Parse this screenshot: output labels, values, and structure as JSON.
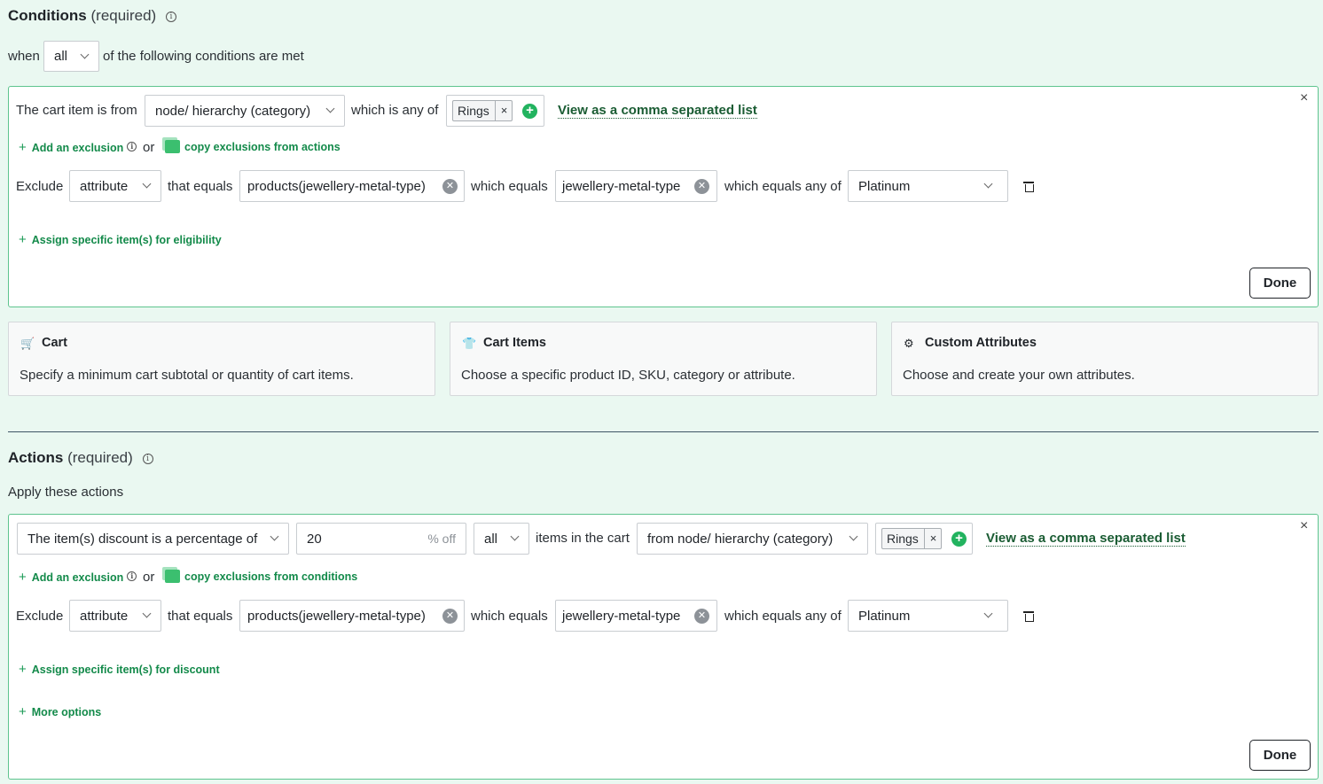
{
  "conditions": {
    "title": "Conditions",
    "required": "(required)",
    "when_label": "when",
    "match_mode": "all",
    "match_suffix": "of the following conditions are met",
    "rule": {
      "prefix": "The cart item is from",
      "source": "node/ hierarchy (category)",
      "which_is_any_of": "which is any of",
      "tag": "Rings",
      "tag_remove": "×",
      "view_list": "View as a comma separated list",
      "add_exclusion": "Add an exclusion",
      "or": "or",
      "copy_exclusions": "copy exclusions from actions",
      "exclude": {
        "label": "Exclude",
        "type": "attribute",
        "that_equals": "that equals",
        "attribute_value": "products(jewellery-metal-type)",
        "which_equals": "which equals",
        "field_value": "jewellery-metal-type",
        "which_equals_any": "which equals any of",
        "option": "Platinum"
      },
      "assign": "Assign specific item(s) for eligibility",
      "done": "Done",
      "close": "×"
    },
    "cards": [
      {
        "icon": "cart-icon",
        "title": "Cart",
        "desc": "Specify a minimum cart subtotal or quantity of cart items."
      },
      {
        "icon": "shirt-icon",
        "title": "Cart Items",
        "desc": "Choose a specific product ID, SKU, category or attribute."
      },
      {
        "icon": "gear-icon",
        "title": "Custom Attributes",
        "desc": "Choose and create your own attributes."
      }
    ]
  },
  "actions": {
    "title": "Actions",
    "required": "(required)",
    "subtitle": "Apply these actions",
    "rule": {
      "discount_type": "The item(s) discount is a percentage of",
      "amount": "20",
      "amount_suffix": "% off",
      "scope": "all",
      "items_in_cart": "items in the cart",
      "source": "from node/ hierarchy (category)",
      "tag": "Rings",
      "tag_remove": "×",
      "view_list": "View as a comma separated list",
      "add_exclusion": "Add an exclusion",
      "or": "or",
      "copy_exclusions": "copy exclusions from conditions",
      "exclude": {
        "label": "Exclude",
        "type": "attribute",
        "that_equals": "that equals",
        "attribute_value": "products(jewellery-metal-type)",
        "which_equals": "which equals",
        "field_value": "jewellery-metal-type",
        "which_equals_any": "which equals any of",
        "option": "Platinum"
      },
      "assign": "Assign specific item(s) for discount",
      "more_options": "More options",
      "done": "Done",
      "close": "×"
    }
  },
  "colors": {
    "accent": "#1a9a55",
    "panel_border": "#5ec48e",
    "background": "#eaf8f1"
  }
}
